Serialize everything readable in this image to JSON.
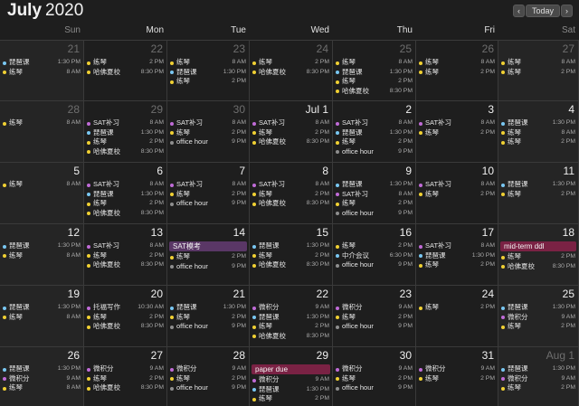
{
  "header": {
    "month": "July",
    "year": "2020",
    "today_label": "Today",
    "prev_glyph": "‹",
    "next_glyph": "›"
  },
  "colors": {
    "blue": "#79c7f2",
    "yellow": "#f0d033",
    "purple": "#c06bd7",
    "gray": "#8e8e8e",
    "allday_purple": "#5a3766",
    "allday_red": "#7a2244"
  },
  "weekdays": [
    "Sun",
    "Mon",
    "Tue",
    "Wed",
    "Thu",
    "Fri",
    "Sat"
  ],
  "weeks": [
    [
      {
        "label": "21",
        "dim": true,
        "events": [
          {
            "t": "琵琶课",
            "time": "1:30 PM",
            "c": "blue"
          },
          {
            "t": "练琴",
            "time": "8 AM",
            "c": "yellow"
          }
        ]
      },
      {
        "label": "22",
        "dim": true,
        "events": [
          {
            "t": "练琴",
            "time": "2 PM",
            "c": "yellow"
          },
          {
            "t": "哈佛夏校",
            "time": "8:30 PM",
            "c": "yellow"
          }
        ]
      },
      {
        "label": "23",
        "dim": true,
        "events": [
          {
            "t": "练琴",
            "time": "8 AM",
            "c": "yellow"
          },
          {
            "t": "琵琶课",
            "time": "1:30 PM",
            "c": "blue"
          },
          {
            "t": "练琴",
            "time": "2 PM",
            "c": "yellow"
          }
        ]
      },
      {
        "label": "24",
        "dim": true,
        "events": [
          {
            "t": "练琴",
            "time": "2 PM",
            "c": "yellow"
          },
          {
            "t": "哈佛夏校",
            "time": "8:30 PM",
            "c": "yellow"
          }
        ]
      },
      {
        "label": "25",
        "dim": true,
        "events": [
          {
            "t": "练琴",
            "time": "8 AM",
            "c": "yellow"
          },
          {
            "t": "琵琶课",
            "time": "1:30 PM",
            "c": "blue"
          },
          {
            "t": "练琴",
            "time": "2 PM",
            "c": "yellow"
          },
          {
            "t": "哈佛夏校",
            "time": "8:30 PM",
            "c": "yellow"
          }
        ]
      },
      {
        "label": "26",
        "dim": true,
        "events": [
          {
            "t": "练琴",
            "time": "8 AM",
            "c": "yellow"
          },
          {
            "t": "练琴",
            "time": "2 PM",
            "c": "yellow"
          }
        ]
      },
      {
        "label": "27",
        "dim": true,
        "events": [
          {
            "t": "练琴",
            "time": "8 AM",
            "c": "yellow"
          },
          {
            "t": "练琴",
            "time": "2 PM",
            "c": "yellow"
          }
        ]
      }
    ],
    [
      {
        "label": "28",
        "dim": true,
        "events": [
          {
            "t": "练琴",
            "time": "8 AM",
            "c": "yellow"
          }
        ]
      },
      {
        "label": "29",
        "dim": true,
        "events": [
          {
            "t": "SAT补习",
            "time": "8 AM",
            "c": "purple"
          },
          {
            "t": "琵琶课",
            "time": "1:30 PM",
            "c": "blue"
          },
          {
            "t": "练琴",
            "time": "2 PM",
            "c": "yellow"
          },
          {
            "t": "哈佛夏校",
            "time": "8:30 PM",
            "c": "yellow"
          }
        ]
      },
      {
        "label": "30",
        "dim": true,
        "events": [
          {
            "t": "SAT补习",
            "time": "8 AM",
            "c": "purple"
          },
          {
            "t": "练琴",
            "time": "2 PM",
            "c": "yellow"
          },
          {
            "t": "office hour",
            "time": "9 PM",
            "c": "gray"
          }
        ]
      },
      {
        "label": "Jul 1",
        "dim": false,
        "events": [
          {
            "t": "SAT补习",
            "time": "8 AM",
            "c": "purple"
          },
          {
            "t": "练琴",
            "time": "2 PM",
            "c": "yellow"
          },
          {
            "t": "哈佛夏校",
            "time": "8:30 PM",
            "c": "yellow"
          }
        ]
      },
      {
        "label": "2",
        "dim": false,
        "events": [
          {
            "t": "SAT补习",
            "time": "8 AM",
            "c": "purple"
          },
          {
            "t": "琵琶课",
            "time": "1:30 PM",
            "c": "blue"
          },
          {
            "t": "练琴",
            "time": "2 PM",
            "c": "yellow"
          },
          {
            "t": "office hour",
            "time": "9 PM",
            "c": "gray"
          }
        ]
      },
      {
        "label": "3",
        "dim": false,
        "events": [
          {
            "t": "SAT补习",
            "time": "8 AM",
            "c": "purple"
          },
          {
            "t": "练琴",
            "time": "2 PM",
            "c": "yellow"
          }
        ]
      },
      {
        "label": "4",
        "dim": false,
        "events": [
          {
            "t": "琵琶课",
            "time": "1:30 PM",
            "c": "blue"
          },
          {
            "t": "练琴",
            "time": "8 AM",
            "c": "yellow"
          },
          {
            "t": "练琴",
            "time": "2 PM",
            "c": "yellow"
          }
        ]
      }
    ],
    [
      {
        "label": "5",
        "dim": false,
        "events": [
          {
            "t": "练琴",
            "time": "8 AM",
            "c": "yellow"
          }
        ]
      },
      {
        "label": "6",
        "dim": false,
        "events": [
          {
            "t": "SAT补习",
            "time": "8 AM",
            "c": "purple"
          },
          {
            "t": "琵琶课",
            "time": "1:30 PM",
            "c": "blue"
          },
          {
            "t": "练琴",
            "time": "2 PM",
            "c": "yellow"
          },
          {
            "t": "哈佛夏校",
            "time": "8:30 PM",
            "c": "yellow"
          }
        ]
      },
      {
        "label": "7",
        "dim": false,
        "events": [
          {
            "t": "SAT补习",
            "time": "8 AM",
            "c": "purple"
          },
          {
            "t": "练琴",
            "time": "2 PM",
            "c": "yellow"
          },
          {
            "t": "office hour",
            "time": "9 PM",
            "c": "gray"
          }
        ]
      },
      {
        "label": "8",
        "dim": false,
        "events": [
          {
            "t": "SAT补习",
            "time": "8 AM",
            "c": "purple"
          },
          {
            "t": "练琴",
            "time": "2 PM",
            "c": "yellow"
          },
          {
            "t": "哈佛夏校",
            "time": "8:30 PM",
            "c": "yellow"
          }
        ]
      },
      {
        "label": "9",
        "dim": false,
        "events": [
          {
            "t": "琵琶课",
            "time": "1:30 PM",
            "c": "blue"
          },
          {
            "t": "SAT补习",
            "time": "8 AM",
            "c": "purple"
          },
          {
            "t": "练琴",
            "time": "2 PM",
            "c": "yellow"
          },
          {
            "t": "office hour",
            "time": "9 PM",
            "c": "gray"
          }
        ]
      },
      {
        "label": "10",
        "dim": false,
        "events": [
          {
            "t": "SAT补习",
            "time": "8 AM",
            "c": "purple"
          },
          {
            "t": "练琴",
            "time": "2 PM",
            "c": "yellow"
          }
        ]
      },
      {
        "label": "11",
        "dim": false,
        "events": [
          {
            "t": "琵琶课",
            "time": "1:30 PM",
            "c": "blue"
          },
          {
            "t": "练琴",
            "time": "2 PM",
            "c": "yellow"
          }
        ]
      }
    ],
    [
      {
        "label": "12",
        "dim": false,
        "events": [
          {
            "t": "琵琶课",
            "time": "1:30 PM",
            "c": "blue"
          },
          {
            "t": "练琴",
            "time": "8 AM",
            "c": "yellow"
          }
        ]
      },
      {
        "label": "13",
        "dim": false,
        "events": [
          {
            "t": "SAT补习",
            "time": "8 AM",
            "c": "purple"
          },
          {
            "t": "练琴",
            "time": "2 PM",
            "c": "yellow"
          },
          {
            "t": "哈佛夏校",
            "time": "8:30 PM",
            "c": "yellow"
          }
        ]
      },
      {
        "label": "14",
        "dim": false,
        "allday": {
          "t": "SAT模考",
          "c": "allday_purple"
        },
        "events": [
          {
            "t": "练琴",
            "time": "2 PM",
            "c": "yellow"
          },
          {
            "t": "office hour",
            "time": "9 PM",
            "c": "gray"
          }
        ]
      },
      {
        "label": "15",
        "dim": false,
        "events": [
          {
            "t": "琵琶课",
            "time": "1:30 PM",
            "c": "blue"
          },
          {
            "t": "练琴",
            "time": "2 PM",
            "c": "yellow"
          },
          {
            "t": "哈佛夏校",
            "time": "8:30 PM",
            "c": "yellow"
          }
        ]
      },
      {
        "label": "16",
        "dim": false,
        "events": [
          {
            "t": "练琴",
            "time": "2 PM",
            "c": "yellow"
          },
          {
            "t": "中介会议",
            "time": "6:30 PM",
            "c": "blue"
          },
          {
            "t": "office hour",
            "time": "9 PM",
            "c": "gray"
          }
        ]
      },
      {
        "label": "17",
        "dim": false,
        "events": [
          {
            "t": "SAT补习",
            "time": "8 AM",
            "c": "purple"
          },
          {
            "t": "琵琶课",
            "time": "1:30 PM",
            "c": "blue"
          },
          {
            "t": "练琴",
            "time": "2 PM",
            "c": "yellow"
          }
        ]
      },
      {
        "label": "18",
        "dim": false,
        "allday": {
          "t": "mid-term ddl",
          "c": "allday_red"
        },
        "events": [
          {
            "t": "练琴",
            "time": "2 PM",
            "c": "yellow"
          },
          {
            "t": "哈佛夏校",
            "time": "8:30 PM",
            "c": "yellow"
          }
        ]
      }
    ],
    [
      {
        "label": "19",
        "dim": false,
        "events": [
          {
            "t": "琵琶课",
            "time": "1:30 PM",
            "c": "blue"
          },
          {
            "t": "练琴",
            "time": "8 AM",
            "c": "yellow"
          }
        ]
      },
      {
        "label": "20",
        "dim": false,
        "events": [
          {
            "t": "托福写作",
            "time": "10:30 AM",
            "c": "purple"
          },
          {
            "t": "练琴",
            "time": "2 PM",
            "c": "yellow"
          },
          {
            "t": "哈佛夏校",
            "time": "8:30 PM",
            "c": "yellow"
          }
        ]
      },
      {
        "label": "21",
        "dim": false,
        "events": [
          {
            "t": "琵琶课",
            "time": "1:30 PM",
            "c": "blue"
          },
          {
            "t": "练琴",
            "time": "2 PM",
            "c": "yellow"
          },
          {
            "t": "office hour",
            "time": "9 PM",
            "c": "gray"
          }
        ]
      },
      {
        "label": "22",
        "dim": false,
        "events": [
          {
            "t": "微积分",
            "time": "9 AM",
            "c": "purple"
          },
          {
            "t": "琵琶课",
            "time": "1:30 PM",
            "c": "blue"
          },
          {
            "t": "练琴",
            "time": "2 PM",
            "c": "yellow"
          },
          {
            "t": "哈佛夏校",
            "time": "8:30 PM",
            "c": "yellow"
          }
        ]
      },
      {
        "label": "23",
        "dim": false,
        "events": [
          {
            "t": "微积分",
            "time": "9 AM",
            "c": "purple"
          },
          {
            "t": "练琴",
            "time": "2 PM",
            "c": "yellow"
          },
          {
            "t": "office hour",
            "time": "9 PM",
            "c": "gray"
          }
        ]
      },
      {
        "label": "24",
        "dim": false,
        "events": [
          {
            "t": "练琴",
            "time": "2 PM",
            "c": "yellow"
          }
        ]
      },
      {
        "label": "25",
        "dim": false,
        "events": [
          {
            "t": "琵琶课",
            "time": "1:30 PM",
            "c": "blue"
          },
          {
            "t": "微积分",
            "time": "9 AM",
            "c": "purple"
          },
          {
            "t": "练琴",
            "time": "2 PM",
            "c": "yellow"
          }
        ]
      }
    ],
    [
      {
        "label": "26",
        "dim": false,
        "events": [
          {
            "t": "琵琶课",
            "time": "1:30 PM",
            "c": "blue"
          },
          {
            "t": "微积分",
            "time": "9 AM",
            "c": "purple"
          },
          {
            "t": "练琴",
            "time": "8 AM",
            "c": "yellow"
          }
        ]
      },
      {
        "label": "27",
        "dim": false,
        "events": [
          {
            "t": "微积分",
            "time": "9 AM",
            "c": "purple"
          },
          {
            "t": "练琴",
            "time": "2 PM",
            "c": "yellow"
          },
          {
            "t": "哈佛夏校",
            "time": "8:30 PM",
            "c": "yellow"
          }
        ]
      },
      {
        "label": "28",
        "dim": false,
        "events": [
          {
            "t": "微积分",
            "time": "9 AM",
            "c": "purple"
          },
          {
            "t": "练琴",
            "time": "2 PM",
            "c": "yellow"
          },
          {
            "t": "office hour",
            "time": "9 PM",
            "c": "gray"
          }
        ]
      },
      {
        "label": "29",
        "dim": false,
        "allday": {
          "t": "paper due",
          "c": "allday_red"
        },
        "events": [
          {
            "t": "微积分",
            "time": "9 AM",
            "c": "purple"
          },
          {
            "t": "琵琶课",
            "time": "1:30 PM",
            "c": "blue"
          },
          {
            "t": "练琴",
            "time": "2 PM",
            "c": "yellow"
          }
        ]
      },
      {
        "label": "30",
        "dim": false,
        "events": [
          {
            "t": "微积分",
            "time": "9 AM",
            "c": "purple"
          },
          {
            "t": "练琴",
            "time": "2 PM",
            "c": "yellow"
          },
          {
            "t": "office hour",
            "time": "9 PM",
            "c": "gray"
          }
        ]
      },
      {
        "label": "31",
        "dim": false,
        "events": [
          {
            "t": "微积分",
            "time": "9 AM",
            "c": "purple"
          },
          {
            "t": "练琴",
            "time": "2 PM",
            "c": "yellow"
          }
        ]
      },
      {
        "label": "Aug 1",
        "dim": true,
        "events": [
          {
            "t": "琵琶课",
            "time": "1:30 PM",
            "c": "blue"
          },
          {
            "t": "微积分",
            "time": "9 AM",
            "c": "purple"
          },
          {
            "t": "练琴",
            "time": "2 PM",
            "c": "yellow"
          }
        ]
      }
    ]
  ]
}
